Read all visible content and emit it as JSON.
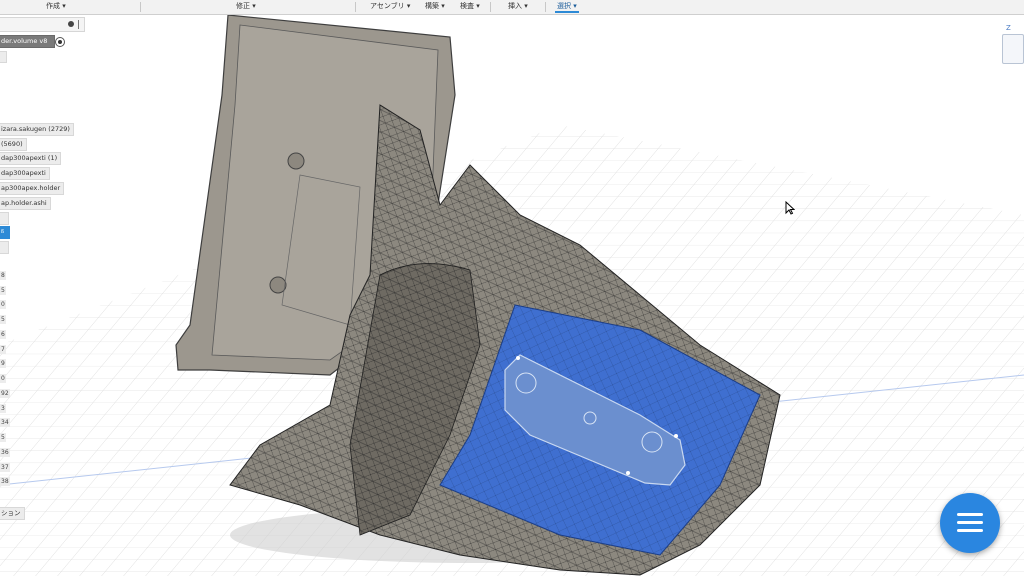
{
  "toolbar": {
    "menus": [
      {
        "label": "作成 ▾"
      },
      {
        "label": "修正 ▾"
      },
      {
        "label": "アセンブリ ▾"
      },
      {
        "label": "構築 ▾"
      },
      {
        "label": "検査 ▾"
      },
      {
        "label": "挿入 ▾"
      },
      {
        "label": "選択 ▾"
      }
    ],
    "active_menu": "選択 ▾"
  },
  "browser": {
    "top_stub": "ł",
    "items": [
      {
        "label": "der.volume v8",
        "state": "selected"
      },
      {
        "label": "izara.sakugen (2729)",
        "state": "normal"
      },
      {
        "label": "(5690)",
        "state": "normal"
      },
      {
        "label": "dap300apexti (1)",
        "state": "normal"
      },
      {
        "label": "dap300apexti",
        "state": "normal"
      },
      {
        "label": "ap300apex.holder",
        "state": "normal"
      },
      {
        "label": "ap.holder.ashi",
        "state": "normal"
      },
      {
        "label": "ß",
        "state": "blue"
      }
    ],
    "row_numbers": [
      "8",
      "5",
      "0",
      "5",
      "6",
      "7",
      "9",
      "0",
      "92",
      "3",
      "34",
      "5",
      "36",
      "37",
      "38"
    ],
    "bottom_label": "ション"
  },
  "viewcube": {
    "axis_label": "Z"
  },
  "colors": {
    "accent_blue": "#2d8ad6",
    "fab_blue": "#2a86e0",
    "model_gray": "#9a958c",
    "selected_face": "#3f6fd0"
  },
  "icons": {
    "fab": "hamburger-menu-icon",
    "cursor": "mouse-pointer-icon"
  }
}
